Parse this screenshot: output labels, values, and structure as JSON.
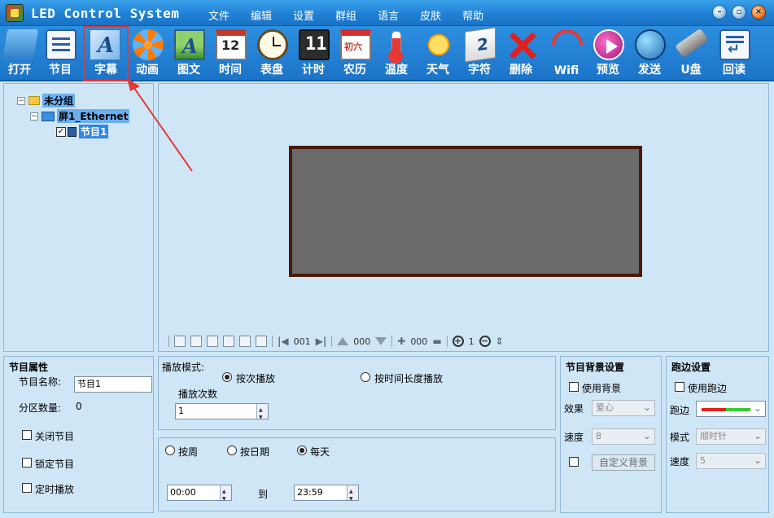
{
  "window": {
    "title": "LED Control System",
    "menu": [
      "文件",
      "编辑",
      "设置",
      "群组",
      "语言",
      "皮肤",
      "帮助"
    ]
  },
  "toolbar": {
    "items": [
      {
        "label": "打开",
        "icon": "open-folder-icon"
      },
      {
        "label": "节目",
        "icon": "program-icon"
      },
      {
        "label": "字幕",
        "icon": "subtitle-icon",
        "selected": true
      },
      {
        "label": "动画",
        "icon": "animation-icon"
      },
      {
        "label": "图文",
        "icon": "image-text-icon"
      },
      {
        "label": "时间",
        "icon": "calendar-time-icon"
      },
      {
        "label": "表盘",
        "icon": "clock-dial-icon"
      },
      {
        "label": "计时",
        "icon": "timer-icon"
      },
      {
        "label": "农历",
        "icon": "lunar-calendar-icon"
      },
      {
        "label": "温度",
        "icon": "thermometer-icon"
      },
      {
        "label": "天气",
        "icon": "weather-sun-icon"
      },
      {
        "label": "字符",
        "icon": "character-icon"
      },
      {
        "label": "删除",
        "icon": "delete-x-icon"
      },
      {
        "label": "Wifi",
        "icon": "wifi-icon"
      },
      {
        "label": "预览",
        "icon": "preview-play-icon"
      },
      {
        "label": "发送",
        "icon": "send-globe-icon"
      },
      {
        "label": "U盘",
        "icon": "usb-drive-icon"
      },
      {
        "label": "回读",
        "icon": "readback-icon"
      }
    ]
  },
  "tree": {
    "group": "未分组",
    "screen": "屏1_Ethernet",
    "program": "节目1"
  },
  "preview": {
    "frame_num": "001",
    "step_num": "000",
    "step_num2": "000",
    "zoom": "1"
  },
  "program_props": {
    "title": "节目属性",
    "name_label": "节目名称:",
    "name_value": "节目1",
    "zones_label": "分区数量:",
    "zones_value": "0",
    "close_label": "关闭节目",
    "lock_label": "锁定节目",
    "timed_label": "定时播放"
  },
  "play_mode": {
    "title": "播放模式:",
    "by_count": "按次播放",
    "by_duration": "按时间长度播放",
    "count_label": "播放次数",
    "count_value": "1"
  },
  "schedule": {
    "by_week": "按周",
    "by_date": "按日期",
    "daily": "每天",
    "from_time": "00:00",
    "to_label": "到",
    "to_time": "23:59"
  },
  "bg_settings": {
    "title": "节目背景设置",
    "use_bg": "使用背景",
    "effect_label": "效果",
    "effect_value": "爱心",
    "speed_label": "速度",
    "speed_value": "8",
    "custom_btn": "自定义背景"
  },
  "border_settings": {
    "title": "跑边设置",
    "use_border": "使用跑边",
    "border_label": "跑边",
    "mode_label": "模式",
    "mode_value": "顺时针",
    "speed_label": "速度",
    "speed_value": "5"
  },
  "colors": {
    "title_bar": "#1f7fd3",
    "panel_bg": "#cfe6f7",
    "led_screen": "#6b6b6b",
    "led_border": "#4a1a08",
    "highlight": "#e53935"
  }
}
